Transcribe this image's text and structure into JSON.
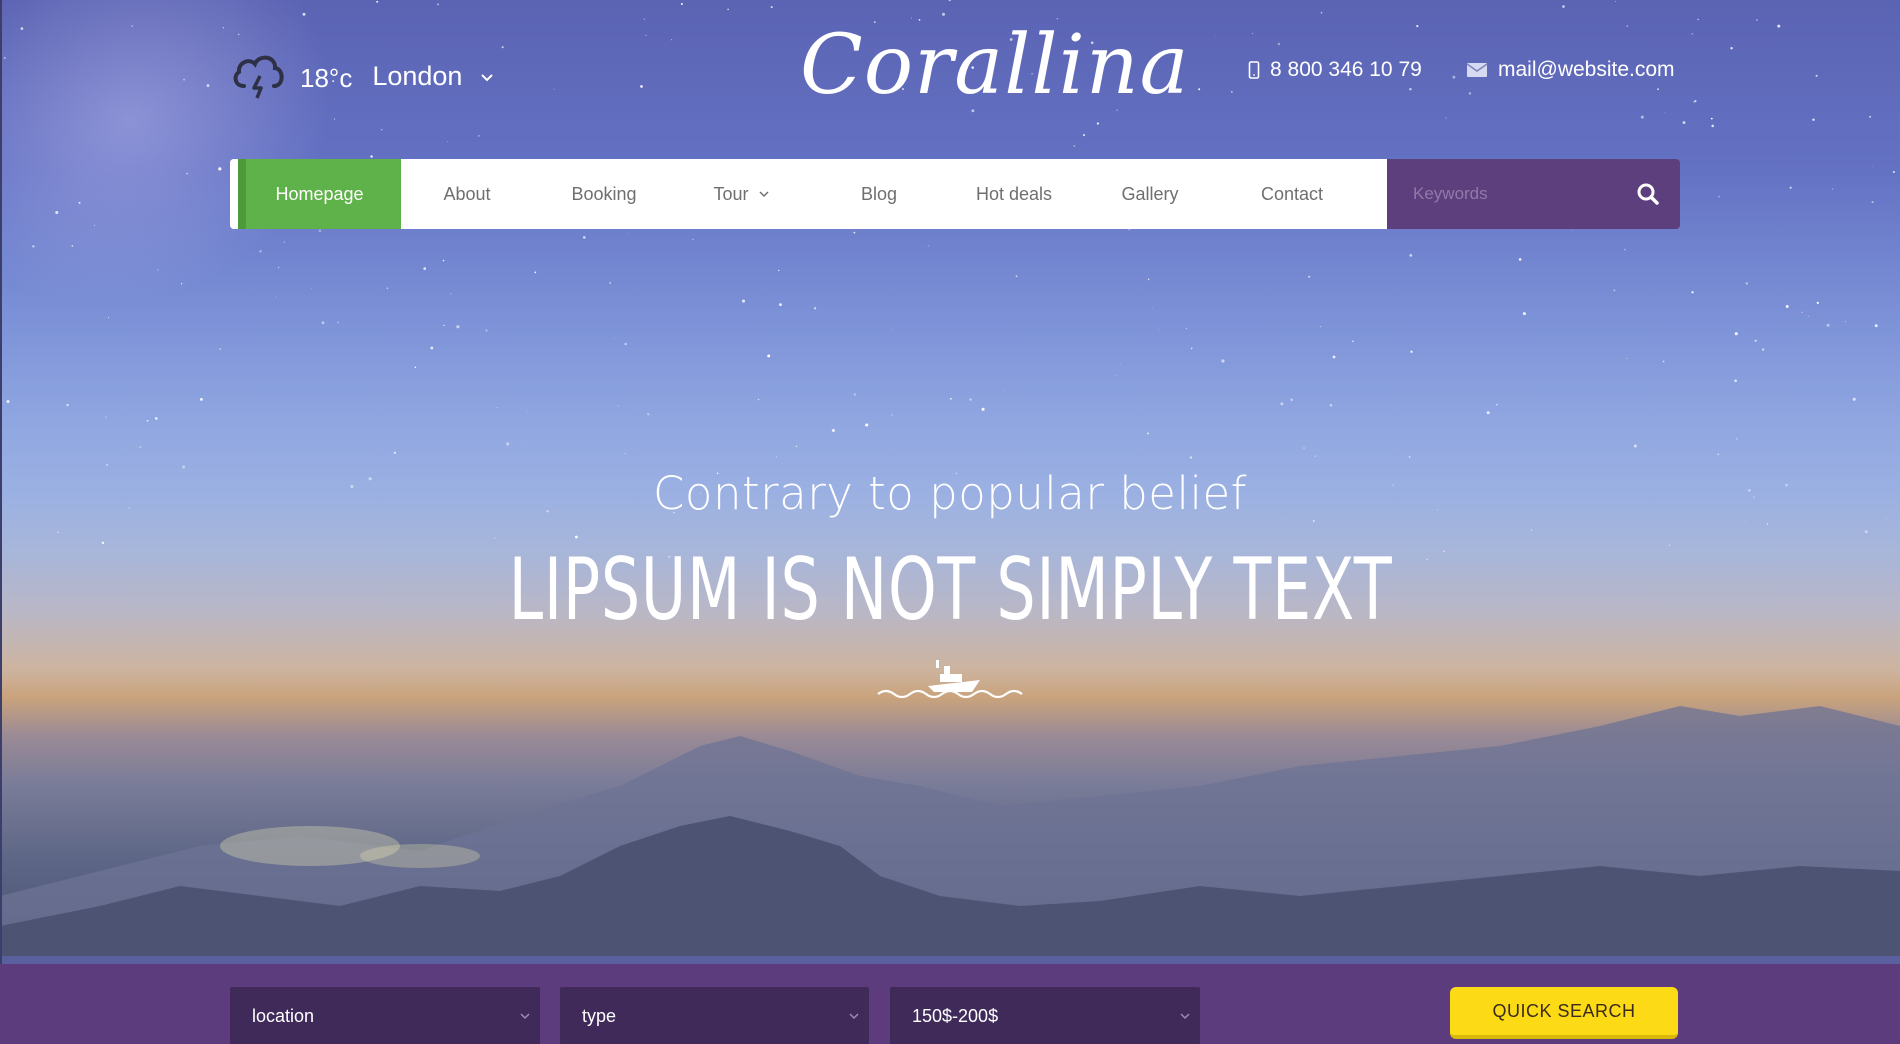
{
  "weather": {
    "temperature": "18°c",
    "city": "London",
    "icon": "storm-cloud-icon"
  },
  "brand": {
    "logo_text": "Corallina"
  },
  "contact": {
    "phone": "8 800 346 10 79",
    "email": "mail@website.com"
  },
  "nav": {
    "items": [
      {
        "label": "Homepage",
        "active": true
      },
      {
        "label": "About"
      },
      {
        "label": "Booking"
      },
      {
        "label": "Tour",
        "dropdown": true
      },
      {
        "label": "Blog"
      },
      {
        "label": "Hot deals"
      },
      {
        "label": "Gallery"
      },
      {
        "label": "Contact"
      }
    ],
    "search_placeholder": "Keywords"
  },
  "hero": {
    "subtitle": "Contrary to popular belief",
    "headline": "LIPSUM IS NOT SIMPLY TEXT"
  },
  "quick_search": {
    "location": "location",
    "type": "type",
    "price": "150$-200$",
    "button_label": "QUICK SEARCH"
  },
  "colors": {
    "accent_green": "#5fb14a",
    "purple": "#5c3c7d",
    "dark_purple": "#3f2a5a",
    "yellow": "#fcdb16"
  }
}
